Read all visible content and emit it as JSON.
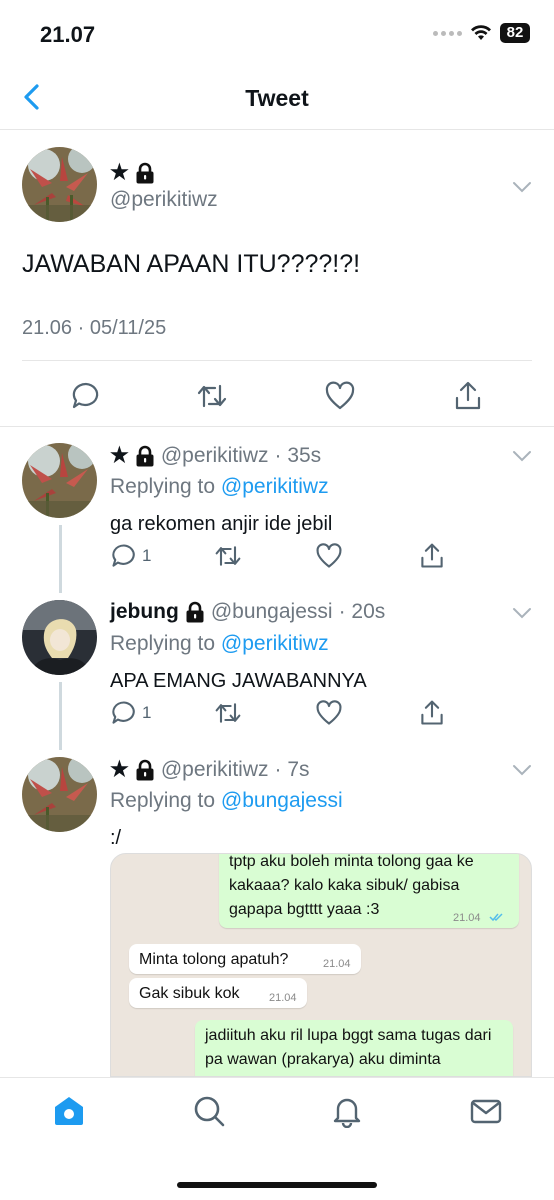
{
  "status_bar": {
    "time": "21.07",
    "battery": "82"
  },
  "header": {
    "title": "Tweet"
  },
  "main_tweet": {
    "display_name": "★",
    "handle": "@perikitiwz",
    "text": "JAWABAN APAAN ITU????!?!",
    "meta": "21.06 · 05/11/25"
  },
  "replies": [
    {
      "display_name": "★",
      "handle": "@perikitiwz",
      "time": "· 35s",
      "replying_prefix": "Replying to",
      "replying_to": "@perikitiwz",
      "text": "ga rekomen anjir ide jebil",
      "reply_count": "1"
    },
    {
      "display_name": "jebung",
      "handle": "@bungajessi",
      "time": "· 20s",
      "replying_prefix": "Replying to",
      "replying_to": "@perikitiwz",
      "text": "APA EMANG JAWABANNYA",
      "reply_count": "1"
    },
    {
      "display_name": "★",
      "handle": "@perikitiwz",
      "time": "· 7s",
      "replying_prefix": "Replying to",
      "replying_to": "@bungajessi",
      "text": ":/"
    }
  ],
  "chat_image": {
    "messages": [
      {
        "direction": "out",
        "text": "tptp aku boleh minta tolong gaa ke kakaaa? kalo kaka sibuk/ gabisa gapapa bgtttt yaaa :3",
        "time": "21.04"
      },
      {
        "direction": "in",
        "text": "Minta tolong apatuh?",
        "time": "21.04"
      },
      {
        "direction": "in",
        "text": "Gak sibuk kok",
        "time": "21.04"
      },
      {
        "direction": "out",
        "text": "jadiituh aku ril lupa bggt sama tugas dari pa wawan (prakarya) aku diminta"
      }
    ]
  },
  "colors": {
    "accent": "#1d9bf0",
    "secondary_text": "#6e7780",
    "chat_out": "#d9fdd3"
  }
}
